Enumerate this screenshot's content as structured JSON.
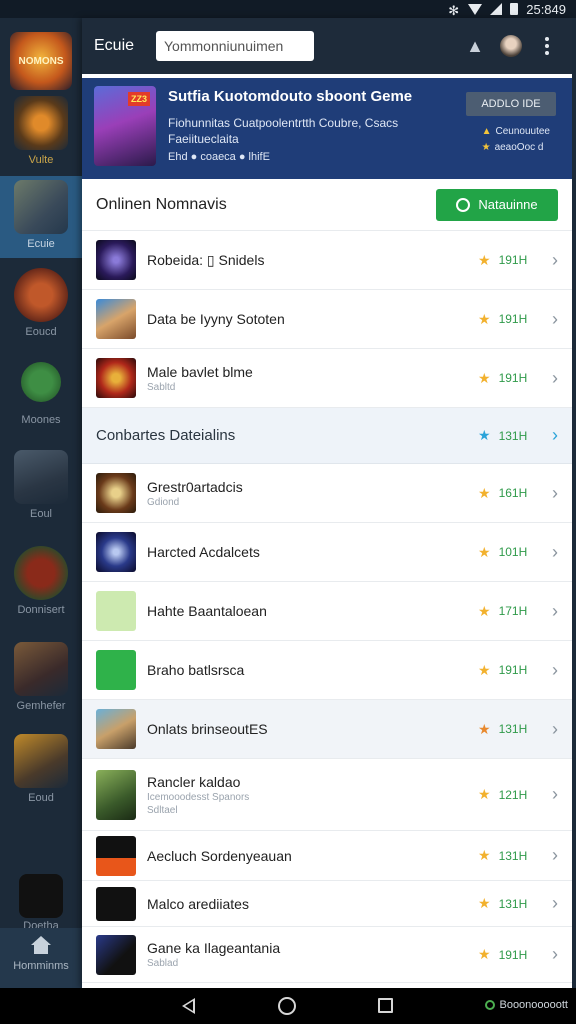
{
  "status_bar": {
    "time": "25:849"
  },
  "rail": {
    "items": [
      {
        "label": "Vulte"
      },
      {
        "label": "Ecuie"
      },
      {
        "label": "Eoucd"
      },
      {
        "label": "Moones"
      },
      {
        "label": "Eoul"
      },
      {
        "label": "Donnisert"
      },
      {
        "label": "Gemhefer"
      },
      {
        "label": "Eoud"
      },
      {
        "label": "Doetha"
      }
    ],
    "home_label": "Homminms"
  },
  "header": {
    "title": "Ecuie",
    "search_value": "Yommonniunuimen"
  },
  "banner": {
    "badge": "ZZ3",
    "title": "Sutfia Kuotomdouto sboont Geme",
    "subtitle_line1": "Fiohunnitas Cuatpoolentrtth Coubre, Csacs",
    "subtitle_line2": "Faeiitueclaita",
    "meta": "Ehd ● coaeca ● lhifE",
    "button_label": "ADDLO IDE",
    "stat1": "Ceunouutee",
    "stat2": "aeaoOoc d"
  },
  "section": {
    "title": "Onlinen Nomnavis",
    "button_label": "Natauinne"
  },
  "rows_top": [
    {
      "name": "Robeida: ▯ Snidels",
      "sub": "",
      "rating": "191H"
    },
    {
      "name": "Data be Iyyny Sototen",
      "sub": "",
      "rating": "191H"
    },
    {
      "name": "Male bavlet blme",
      "sub": "Sabltd",
      "rating": "191H"
    }
  ],
  "category": {
    "title": "Conbartes Dateialins",
    "rating": "131H"
  },
  "rows_bottom": [
    {
      "name": "Grestr0artadcis",
      "sub": "Gdiond",
      "rating": "161H"
    },
    {
      "name": "Harcted Acdalcets",
      "sub": "",
      "rating": "101H"
    },
    {
      "name": "Hahte Baantaloean",
      "sub": "",
      "rating": "171H"
    },
    {
      "name": "Braho batlsrsca",
      "sub": "",
      "rating": "191H"
    },
    {
      "name": "Onlats brinseoutES",
      "sub": "",
      "rating": "131H"
    },
    {
      "name": "Rancler kaldao",
      "sub": "Icemooodesst Spanors",
      "sub2": "Sdltael",
      "rating": "121H"
    },
    {
      "name": "Aecluch Sordenyeauan",
      "sub": "",
      "rating": "131H"
    },
    {
      "name": "Malco arediiates",
      "sub": "",
      "rating": "131H"
    },
    {
      "name": "Gane ka Ilageantania",
      "sub": "Sablad",
      "rating": "191H"
    }
  ],
  "nav_status": "Booonooooott"
}
